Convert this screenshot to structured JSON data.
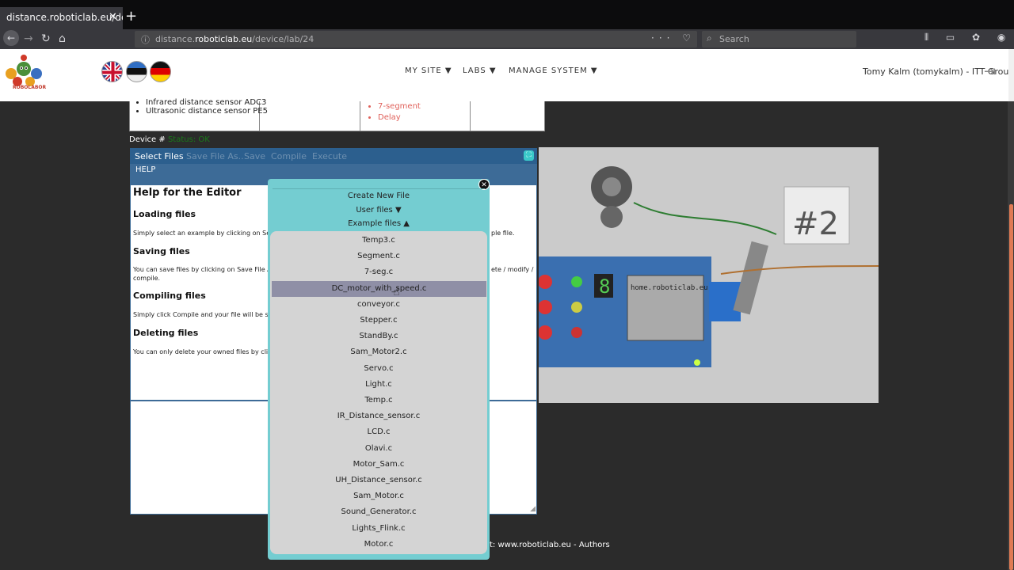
{
  "browser": {
    "tab_title": "distance.roboticlab.eu/devi",
    "tab_close": "✕",
    "new_tab": "+",
    "url_scheme_host_prefix": "distance.",
    "url_host": "roboticlab.eu",
    "url_path": "/device/lab/24",
    "url_actions": "··· ♡ ☆",
    "search_placeholder": "Search",
    "toolbar_icons": "⫴ ▭ ✿ ◉ ≡",
    "back": "←",
    "forward": "→",
    "reload": "↻",
    "home": "⌂",
    "info": "ⓘ",
    "search_glyph": "⌕"
  },
  "header": {
    "logo_text": "ROBOLABOR",
    "nav": {
      "my_site": "MY SITE ▼",
      "labs": "LABS ▼",
      "manage_system": "MANAGE SYSTEM ▼"
    },
    "user": "Tomy Kalm (tomykalm) - ITT Group",
    "logout_glyph": "⇥"
  },
  "info_table": {
    "sensors": [
      "Infrared distance sensor ADC3",
      "Ultrasonic distance sensor PE5"
    ],
    "examples": [
      "7-segment",
      "Delay"
    ]
  },
  "device": {
    "label": "Device #",
    "status": "Status: OK"
  },
  "editor": {
    "toolbar": {
      "select_files": "Select Files",
      "save_file_as": "Save File As..",
      "save": "Save",
      "compile": "Compile",
      "execute": "Execute"
    },
    "help_label": "HELP",
    "help": {
      "title": "Help for the Editor",
      "loading_title": "Loading files",
      "loading_text": "Simply select an example by clicking on Select",
      "loading_text_tail": "ple file.",
      "saving_title": "Saving files",
      "saving_text": "You can save files by clicking on Save File As.",
      "saving_text_tail": "ete / modify /",
      "saving_text_2": "compile.",
      "compiling_title": "Compiling files",
      "compiling_text": "Simply click Compile and your file will be save",
      "deleting_title": "Deleting files",
      "deleting_text": "You can only delete your owned files by clickin"
    }
  },
  "footer": {
    "text": "t: www.roboticlab.eu - Authors"
  },
  "file_dialog": {
    "close": "✕",
    "create_new": "Create New File",
    "user_files": "User files ▼",
    "example_files": "Example files ▲",
    "files": [
      "Temp3.c",
      "Segment.c",
      "7-seg.c",
      "DC_motor_with_speed.c",
      "conveyor.c",
      "Stepper.c",
      "StandBy.c",
      "Sam_Motor2.c",
      "Servo.c",
      "Light.c",
      "Temp.c",
      "IR_Distance_sensor.c",
      "LCD.c",
      "Olavi.c",
      "Motor_Sam.c",
      "UH_Distance_sensor.c",
      "Sam_Motor.c",
      "Sound_Generator.c",
      "Lights_Flink.c",
      "Motor.c"
    ],
    "selected_file": "DC_motor_with_speed.c"
  },
  "camera": {
    "label": "#2",
    "board_label": "home.roboticlab.eu",
    "segment_digit": "8"
  }
}
